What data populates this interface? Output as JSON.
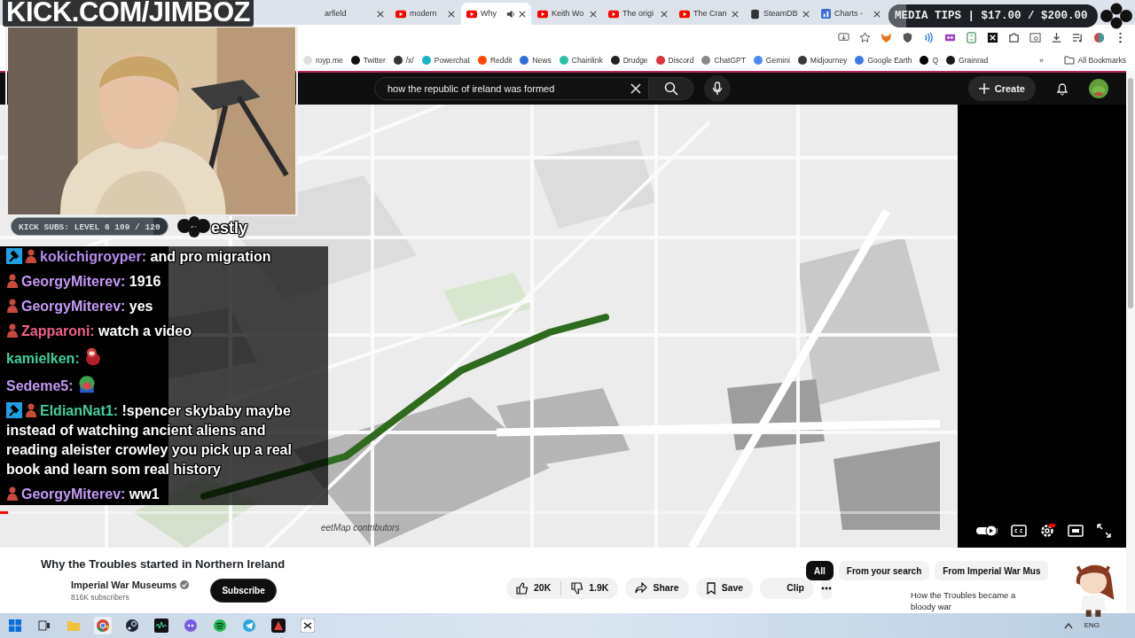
{
  "stream_overlay": {
    "channel_url": "KICK.COM/JIMBOZ",
    "subs_goal": {
      "label": "KICK SUBS: LEVEL 6 109 / 120",
      "level": 0.91
    },
    "alert_text": "estly",
    "media_tips": {
      "label": "MEDIA TIPS | $17.00 / $200.00",
      "level": 0.085
    }
  },
  "chat": [
    {
      "user": "kokichigroyper:",
      "color": "#b48cf0",
      "moderator": true,
      "subscriber": true,
      "kind": "text",
      "text": "and pro migration"
    },
    {
      "user": "GeorgyMiterev:",
      "color": "#c39af5",
      "moderator": false,
      "subscriber": true,
      "kind": "text",
      "text": "1916"
    },
    {
      "user": "GeorgyMiterev:",
      "color": "#c39af5",
      "moderator": false,
      "subscriber": true,
      "kind": "text",
      "text": "yes"
    },
    {
      "user": "Zapparoni:",
      "color": "#f0608a",
      "moderator": false,
      "subscriber": true,
      "kind": "text",
      "text": "watch a video"
    },
    {
      "user": "kamielken:",
      "color": "#3fcf9f",
      "moderator": false,
      "subscriber": false,
      "kind": "emote"
    },
    {
      "user": "Sedeme5:",
      "color": "#c39af5",
      "moderator": false,
      "subscriber": false,
      "kind": "emote"
    },
    {
      "user": "EldianNat1:",
      "color": "#3fcf9f",
      "moderator": true,
      "subscriber": true,
      "kind": "text",
      "text": "!spencer skybaby maybe instead of watching ancient aliens and reading aleister crowley you pick up a real book and learn som real history"
    },
    {
      "user": "GeorgyMiterev:",
      "color": "#c39af5",
      "moderator": false,
      "subscriber": true,
      "kind": "text",
      "text": "ww1"
    }
  ],
  "browser": {
    "tabs": [
      {
        "title": "arfield",
        "kind": "none",
        "selected": false,
        "playing_audio": false
      },
      {
        "title": "modern",
        "kind": "video",
        "selected": false,
        "playing_audio": false
      },
      {
        "title": "Why",
        "kind": "video",
        "selected": true,
        "playing_audio": true
      },
      {
        "title": "Keith Wo",
        "kind": "video",
        "selected": false,
        "playing_audio": false
      },
      {
        "title": "The origi",
        "kind": "video",
        "selected": false,
        "playing_audio": false
      },
      {
        "title": "The Cran",
        "kind": "video",
        "selected": false,
        "playing_audio": false
      },
      {
        "title": "SteamDB",
        "kind": "database",
        "selected": false,
        "playing_audio": false
      },
      {
        "title": "Charts -",
        "kind": "chart",
        "selected": false,
        "playing_audio": false
      }
    ],
    "bookmarks": [
      {
        "label": "royp.me",
        "color": "#e0e0e0"
      },
      {
        "label": "Twitter",
        "color": "#111111"
      },
      {
        "label": "/x/",
        "color": "#333333"
      },
      {
        "label": "Powerchat",
        "color": "#19b3c8"
      },
      {
        "label": "Reddit",
        "color": "#ff4500"
      },
      {
        "label": "News",
        "color": "#2a6fdb"
      },
      {
        "label": "Chainlink",
        "color": "#21c2a8"
      },
      {
        "label": "Drudge",
        "color": "#222222"
      },
      {
        "label": "Discord",
        "color": "#e0303a"
      },
      {
        "label": "ChatGPT",
        "color": "#8a8a8a"
      },
      {
        "label": "Gemini",
        "color": "#4a8af4"
      },
      {
        "label": "Midjourney",
        "color": "#3a3a3a"
      },
      {
        "label": "Google Earth",
        "color": "#3b7be8"
      },
      {
        "label": "Q",
        "color": "#000000"
      },
      {
        "label": "Grainrad",
        "color": "#1a1a1a"
      }
    ],
    "more_bookmarks": "»",
    "all_bookmarks": "All Bookmarks"
  },
  "youtube": {
    "search": {
      "value": "how the republic of ireland was formed"
    },
    "create": "Create",
    "player": {
      "attribution": "eetMap contributors",
      "level": 0.008,
      "autoplay": true
    },
    "title": "Why the Troubles started in Northern Ireland",
    "channel": "Imperial War Museums",
    "subscribers": "816K subscribers",
    "subscribe": "Subscribe",
    "likes": "20K",
    "dislikes": "1.9K",
    "actions": [
      {
        "kind": "share",
        "label": "Share"
      },
      {
        "kind": "save",
        "label": "Save"
      },
      {
        "kind": "clip",
        "label": "Clip"
      }
    ],
    "chips": [
      {
        "label": "All",
        "selected": true
      },
      {
        "label": "From your search",
        "selected": false
      },
      {
        "label": "From Imperial War Mus",
        "selected": false
      }
    ],
    "related": {
      "title": "How the Troubles became a bloody war"
    }
  },
  "taskbar": {
    "language": "ENG"
  }
}
